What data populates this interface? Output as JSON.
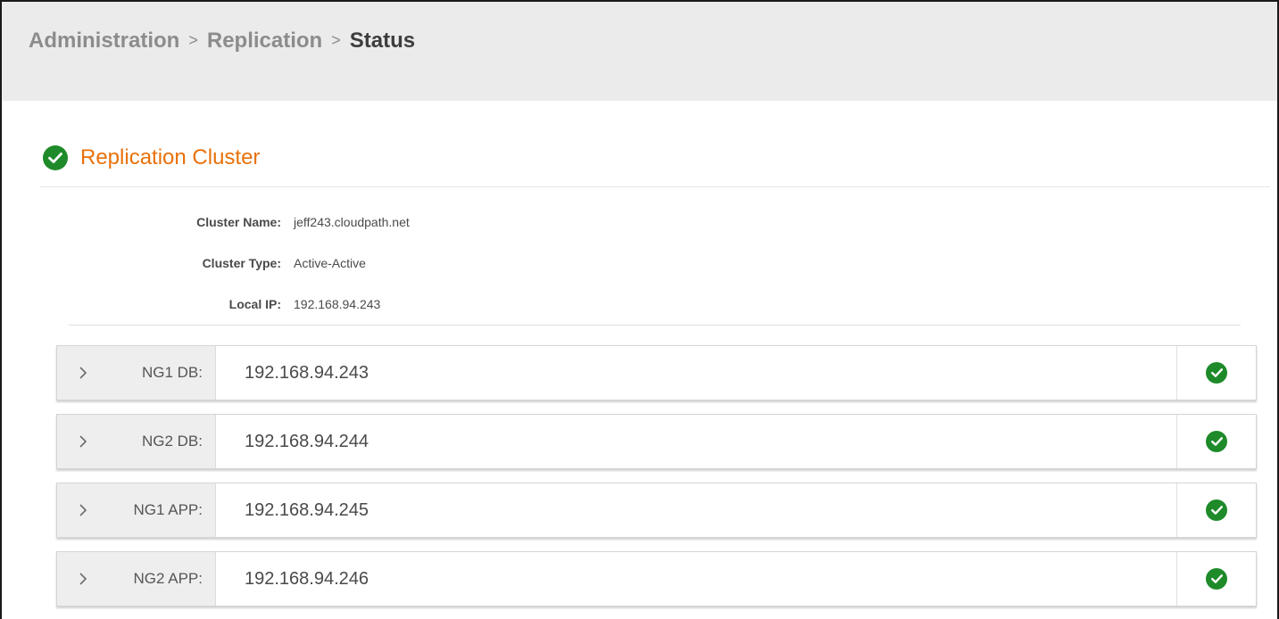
{
  "breadcrumb": {
    "items": [
      "Administration",
      "Replication"
    ],
    "separator": ">",
    "current": "Status"
  },
  "section": {
    "title": "Replication Cluster",
    "status_icon": "check-circle-icon",
    "status_color": "#1e8a2a",
    "title_color": "#e8710a"
  },
  "cluster_info": [
    {
      "label": "Cluster Name:",
      "value": "jeff243.cloudpath.net"
    },
    {
      "label": "Cluster Type:",
      "value": "Active-Active"
    },
    {
      "label": "Local IP:",
      "value": "192.168.94.243"
    }
  ],
  "nodes": [
    {
      "label": "NG1 DB:",
      "ip": "192.168.94.243",
      "status": "ok"
    },
    {
      "label": "NG2 DB:",
      "ip": "192.168.94.244",
      "status": "ok"
    },
    {
      "label": "NG1 APP:",
      "ip": "192.168.94.245",
      "status": "ok"
    },
    {
      "label": "NG2 APP:",
      "ip": "192.168.94.246",
      "status": "ok"
    }
  ]
}
